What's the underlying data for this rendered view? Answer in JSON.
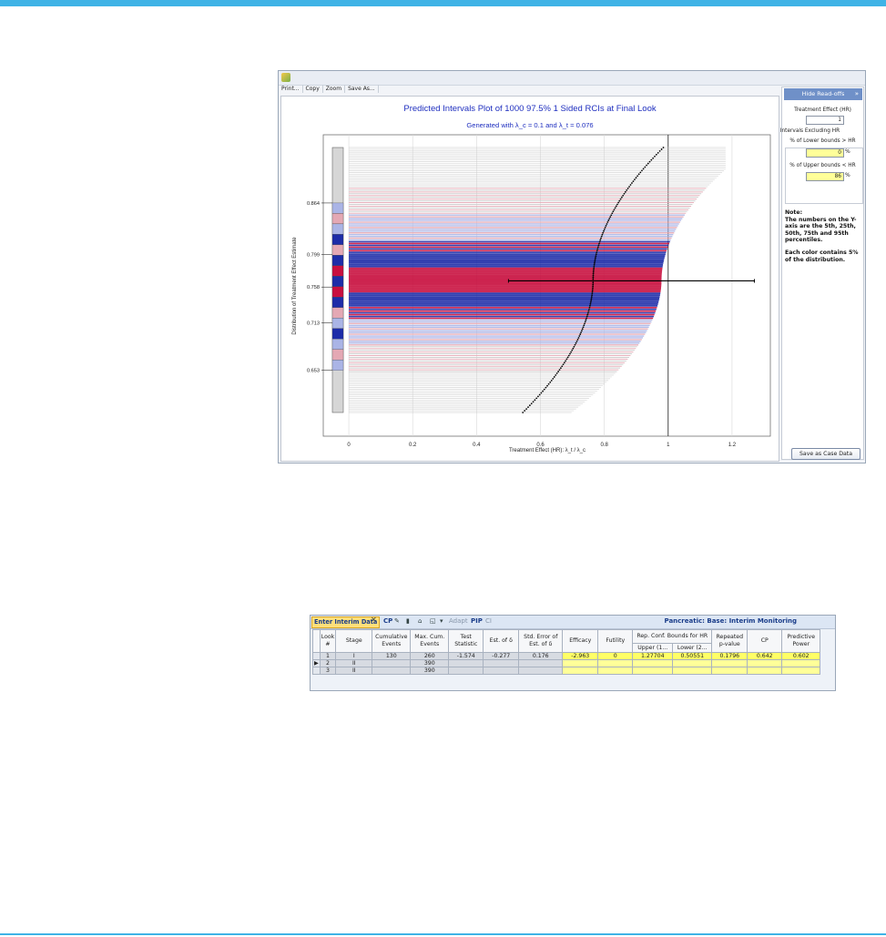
{
  "plot_window": {
    "toolbar": {
      "print": "Print...",
      "copy": "Copy",
      "zoom": "Zoom",
      "save_as": "Save As..."
    }
  },
  "side_panel": {
    "hide_button": "Hide Read-offs",
    "close_glyph": "»",
    "treatment_effect_label": "Treatment Effect (HR)",
    "treatment_effect_value": "1",
    "group_label": "Intervals Excluding HR",
    "lower_label": "% of Lower bounds > HR",
    "lower_value": "0",
    "lower_unit": "%",
    "upper_label": "% of Upper bounds < HR",
    "upper_value": "86",
    "upper_unit": "%",
    "note_title": "Note:",
    "note_text": "The numbers on the Y-axis are the 5th, 25th, 50th, 75th and 95th percentiles.",
    "note_text2": "Each color contains 5% of the distribution.",
    "save_case_button": "Save as Case Data"
  },
  "chart_data": {
    "type": "scatter",
    "title": "Predicted Intervals Plot of 1000 97.5% 1 Sided RCIs at Final Look",
    "subtitle": "Generated with λ_c = 0.1 and λ_t = 0.076",
    "xlabel": "Treatment Effect (HR): λ_t / λ_c",
    "ylabel": "Distribution of Treatment Effect Estimate",
    "x_ticks": [
      "0",
      "0.2",
      "0.4",
      "0.6",
      "0.8",
      "1",
      "1.2"
    ],
    "xlim": [
      -0.08,
      1.32
    ],
    "y_ticks": [
      "0.864",
      "0.799",
      "0.758",
      "0.713",
      "0.653"
    ],
    "ylim": [
      0.57,
      0.95
    ],
    "reference_line_x": 1,
    "highlight_interval": {
      "y": 0.758,
      "lower": 0.5,
      "upper": 1.27
    },
    "estimate_range": [
      0.545,
      0.985
    ],
    "interval_count": 1000,
    "colors": {
      "dark_band": "#1d2ca8",
      "median_band": "#c80f3f",
      "light_band": "#aab4e6",
      "pink_band": "#e4a8b4",
      "tail_line": "#c9c9c9",
      "point": "#000000"
    }
  },
  "grid": {
    "toolbar": {
      "enter_interim": "Enter Interim Data",
      "cp": "CP",
      "adapt": "Adapt",
      "pip": "PIP",
      "ci": "CI",
      "title": "Pancreatic: Base: Interim Monitoring"
    },
    "headers": {
      "look": "Look #",
      "stage": "Stage",
      "cum_events": "Cumulative Events",
      "max_cum_events": "Max. Cum. Events",
      "test_stat": "Test Statistic",
      "est_delta": "Est. of δ",
      "se_delta": "Std. Error of Est. of δ",
      "efficacy": "Efficacy",
      "futility": "Futility",
      "rep_conf": "Rep. Conf. Bounds for HR",
      "upper": "Upper (1...",
      "lower": "Lower (2...",
      "rep_pval": "Repeated p-value",
      "cp": "CP",
      "pred_power": "Predictive Power"
    },
    "rows": [
      {
        "marker": "",
        "look": "1",
        "stage": "I",
        "cum": "130",
        "max": "260",
        "test": "-1.574",
        "est": "-0.277",
        "se": "0.176",
        "eff": "-2.963",
        "fut": "0",
        "upper": "1.27704",
        "lower": "0.50551",
        "pval": "0.1796",
        "cp": "0.642",
        "pp": "0.602"
      },
      {
        "marker": "▶",
        "look": "2",
        "stage": "II",
        "cum": "",
        "max": "390",
        "test": "",
        "est": "",
        "se": "",
        "eff": "",
        "fut": "",
        "upper": "",
        "lower": "",
        "pval": "",
        "cp": "",
        "pp": ""
      },
      {
        "marker": "",
        "look": "3",
        "stage": "II",
        "cum": "",
        "max": "390",
        "test": "",
        "est": "",
        "se": "",
        "eff": "",
        "fut": "",
        "upper": "",
        "lower": "",
        "pval": "",
        "cp": "",
        "pp": ""
      }
    ]
  }
}
